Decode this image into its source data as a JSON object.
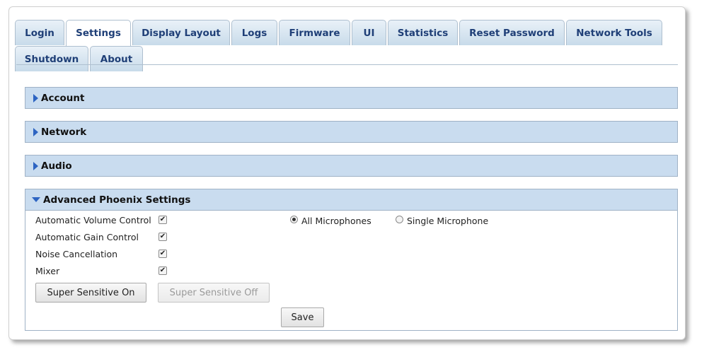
{
  "tabs_row1": [
    "Login",
    "Settings",
    "Display Layout",
    "Logs",
    "Firmware",
    "UI",
    "Statistics",
    "Reset Password",
    "Network Tools"
  ],
  "tabs_row2": [
    "Shutdown",
    "About"
  ],
  "active_tab": "Settings",
  "panels": {
    "account": "Account",
    "network": "Network",
    "audio": "Audio",
    "advanced": "Advanced Phoenix Settings"
  },
  "advanced": {
    "options": [
      {
        "label": "Automatic Volume Control",
        "checked": true
      },
      {
        "label": "Automatic Gain Control",
        "checked": true
      },
      {
        "label": "Noise Cancellation",
        "checked": true
      },
      {
        "label": "Mixer",
        "checked": true
      }
    ],
    "mic_mode": {
      "all_label": "All Microphones",
      "single_label": "Single Microphone",
      "selected": "all"
    },
    "super_sensitive_on_label": "Super Sensitive On",
    "super_sensitive_off_label": "Super Sensitive Off",
    "save_label": "Save"
  },
  "colors": {
    "tab_text": "#1f3f77",
    "panel_bg": "#c9dcef",
    "arrow": "#2d64c2"
  }
}
